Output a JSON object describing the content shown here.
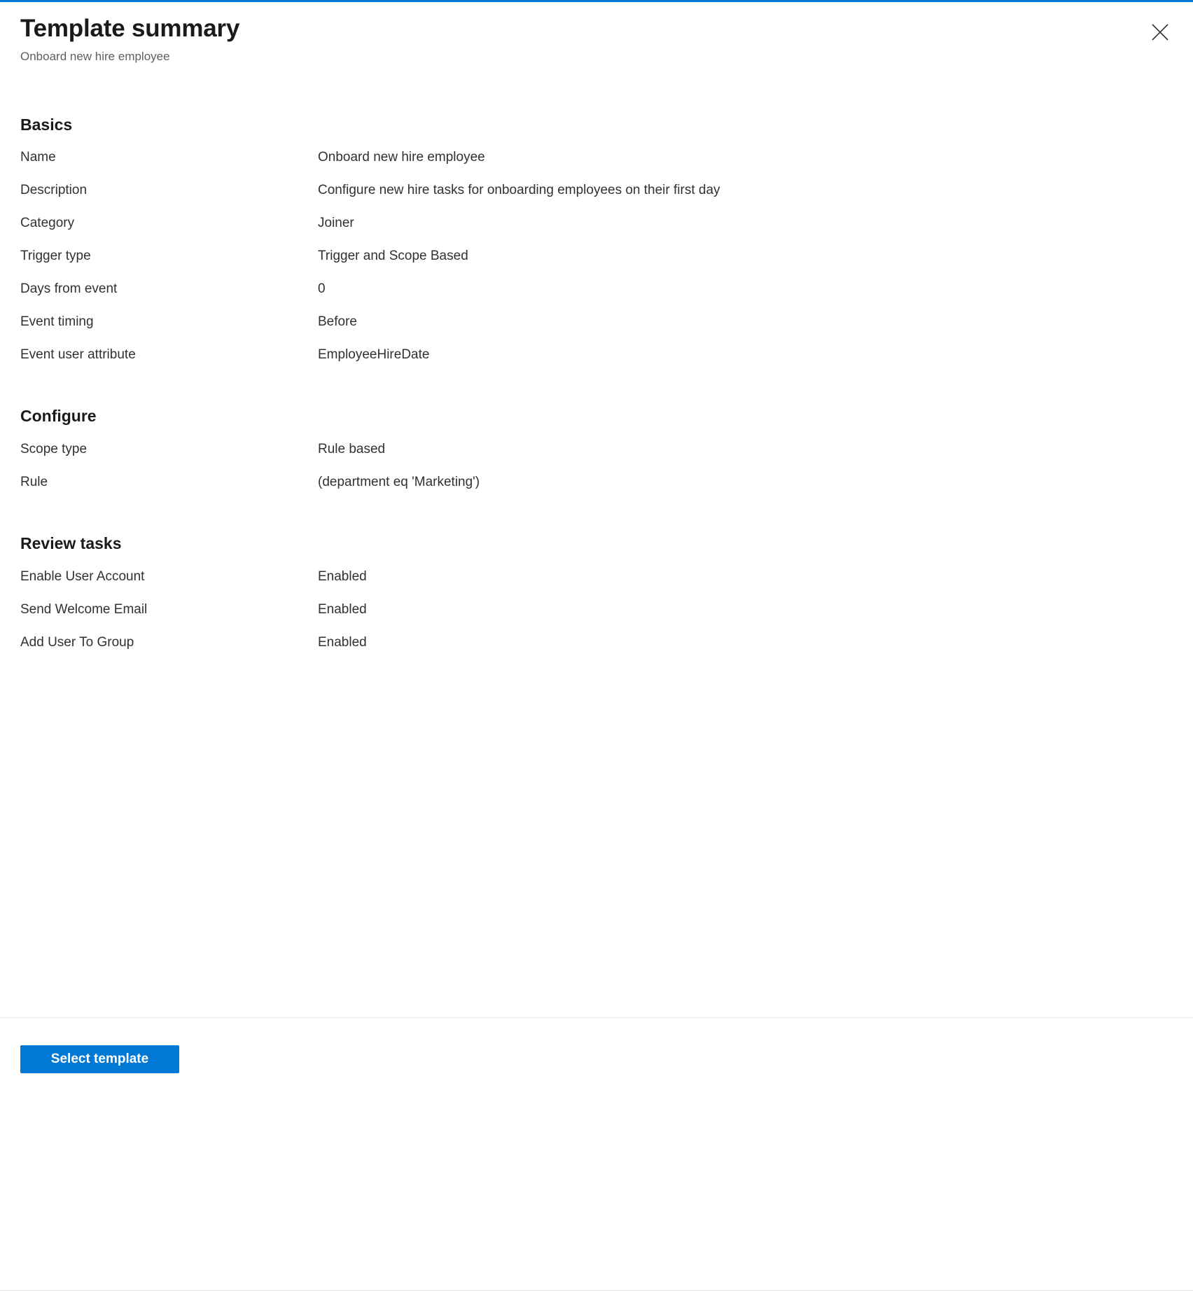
{
  "window": {
    "accent_color": "#0078d4",
    "title": "Template summary",
    "subtitle": "Onboard new hire employee",
    "close_label": "Close"
  },
  "sections": [
    {
      "heading": "Basics",
      "rows": [
        {
          "label": "Name",
          "value": "Onboard new hire employee"
        },
        {
          "label": "Description",
          "value": "Configure new hire tasks for onboarding employees on their first day"
        },
        {
          "label": "Category",
          "value": "Joiner"
        },
        {
          "label": "Trigger type",
          "value": "Trigger and Scope Based"
        },
        {
          "label": "Days from event",
          "value": "0"
        },
        {
          "label": "Event timing",
          "value": "Before"
        },
        {
          "label": "Event user attribute",
          "value": "EmployeeHireDate"
        }
      ]
    },
    {
      "heading": "Configure",
      "rows": [
        {
          "label": "Scope type",
          "value": "Rule based"
        },
        {
          "label": "Rule",
          "value": "(department eq 'Marketing')"
        }
      ]
    },
    {
      "heading": "Review tasks",
      "rows": [
        {
          "label": "Enable User Account",
          "value": "Enabled"
        },
        {
          "label": "Send Welcome Email",
          "value": "Enabled"
        },
        {
          "label": "Add User To Group",
          "value": "Enabled"
        }
      ]
    }
  ],
  "footer": {
    "primary_button_label": "Select template"
  }
}
